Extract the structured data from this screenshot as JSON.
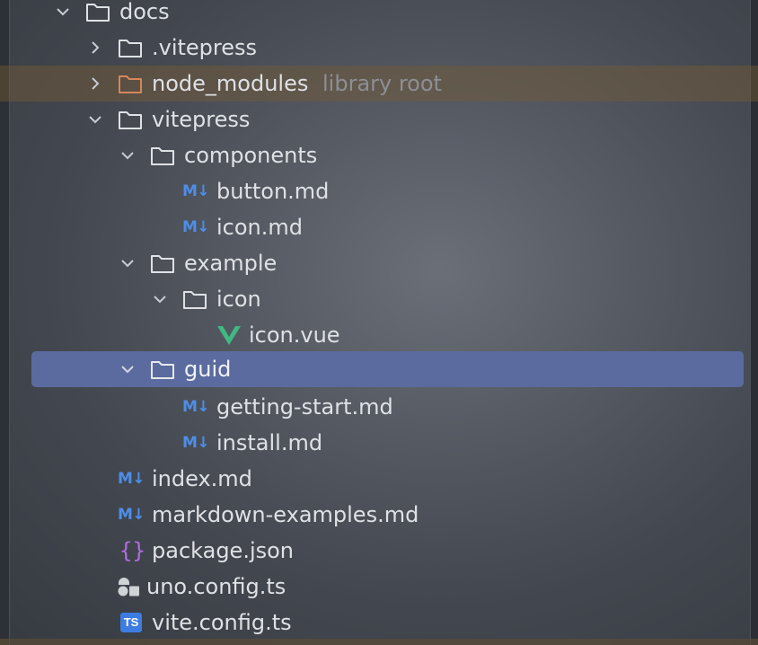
{
  "tree": {
    "rows": [
      {
        "label": "docs",
        "kind": "folder",
        "expanded": true
      },
      {
        "label": ".vitepress",
        "kind": "folder",
        "expanded": false
      },
      {
        "label": "node_modules",
        "kind": "folder-library",
        "expanded": false,
        "hint": "library root"
      },
      {
        "label": "vitepress",
        "kind": "folder",
        "expanded": true
      },
      {
        "label": "components",
        "kind": "folder",
        "expanded": true
      },
      {
        "label": "button.md",
        "kind": "markdown"
      },
      {
        "label": "icon.md",
        "kind": "markdown"
      },
      {
        "label": "example",
        "kind": "folder",
        "expanded": true
      },
      {
        "label": "icon",
        "kind": "folder",
        "expanded": true
      },
      {
        "label": "icon.vue",
        "kind": "vue"
      },
      {
        "label": "guid",
        "kind": "folder",
        "expanded": true,
        "selected": true
      },
      {
        "label": "getting-start.md",
        "kind": "markdown"
      },
      {
        "label": "install.md",
        "kind": "markdown"
      },
      {
        "label": "index.md",
        "kind": "markdown"
      },
      {
        "label": "markdown-examples.md",
        "kind": "markdown"
      },
      {
        "label": "package.json",
        "kind": "json"
      },
      {
        "label": "uno.config.ts",
        "kind": "uno"
      },
      {
        "label": "vite.config.ts",
        "kind": "typescript"
      }
    ]
  },
  "badges": {
    "markdown": "M↓",
    "json": "{}",
    "typescript": "TS"
  },
  "colors": {
    "text": "#dfe1e5",
    "hint": "#8d8f95",
    "selection": "#5b6b9f",
    "library_highlight": "#765c36",
    "folder_outline": "#dfe1e5",
    "library_folder": "#d5875c",
    "markdown_icon": "#4d8ee8",
    "vue_green": "#41b883",
    "json_purple": "#b06ee0",
    "ts_blue": "#3d7de1"
  }
}
